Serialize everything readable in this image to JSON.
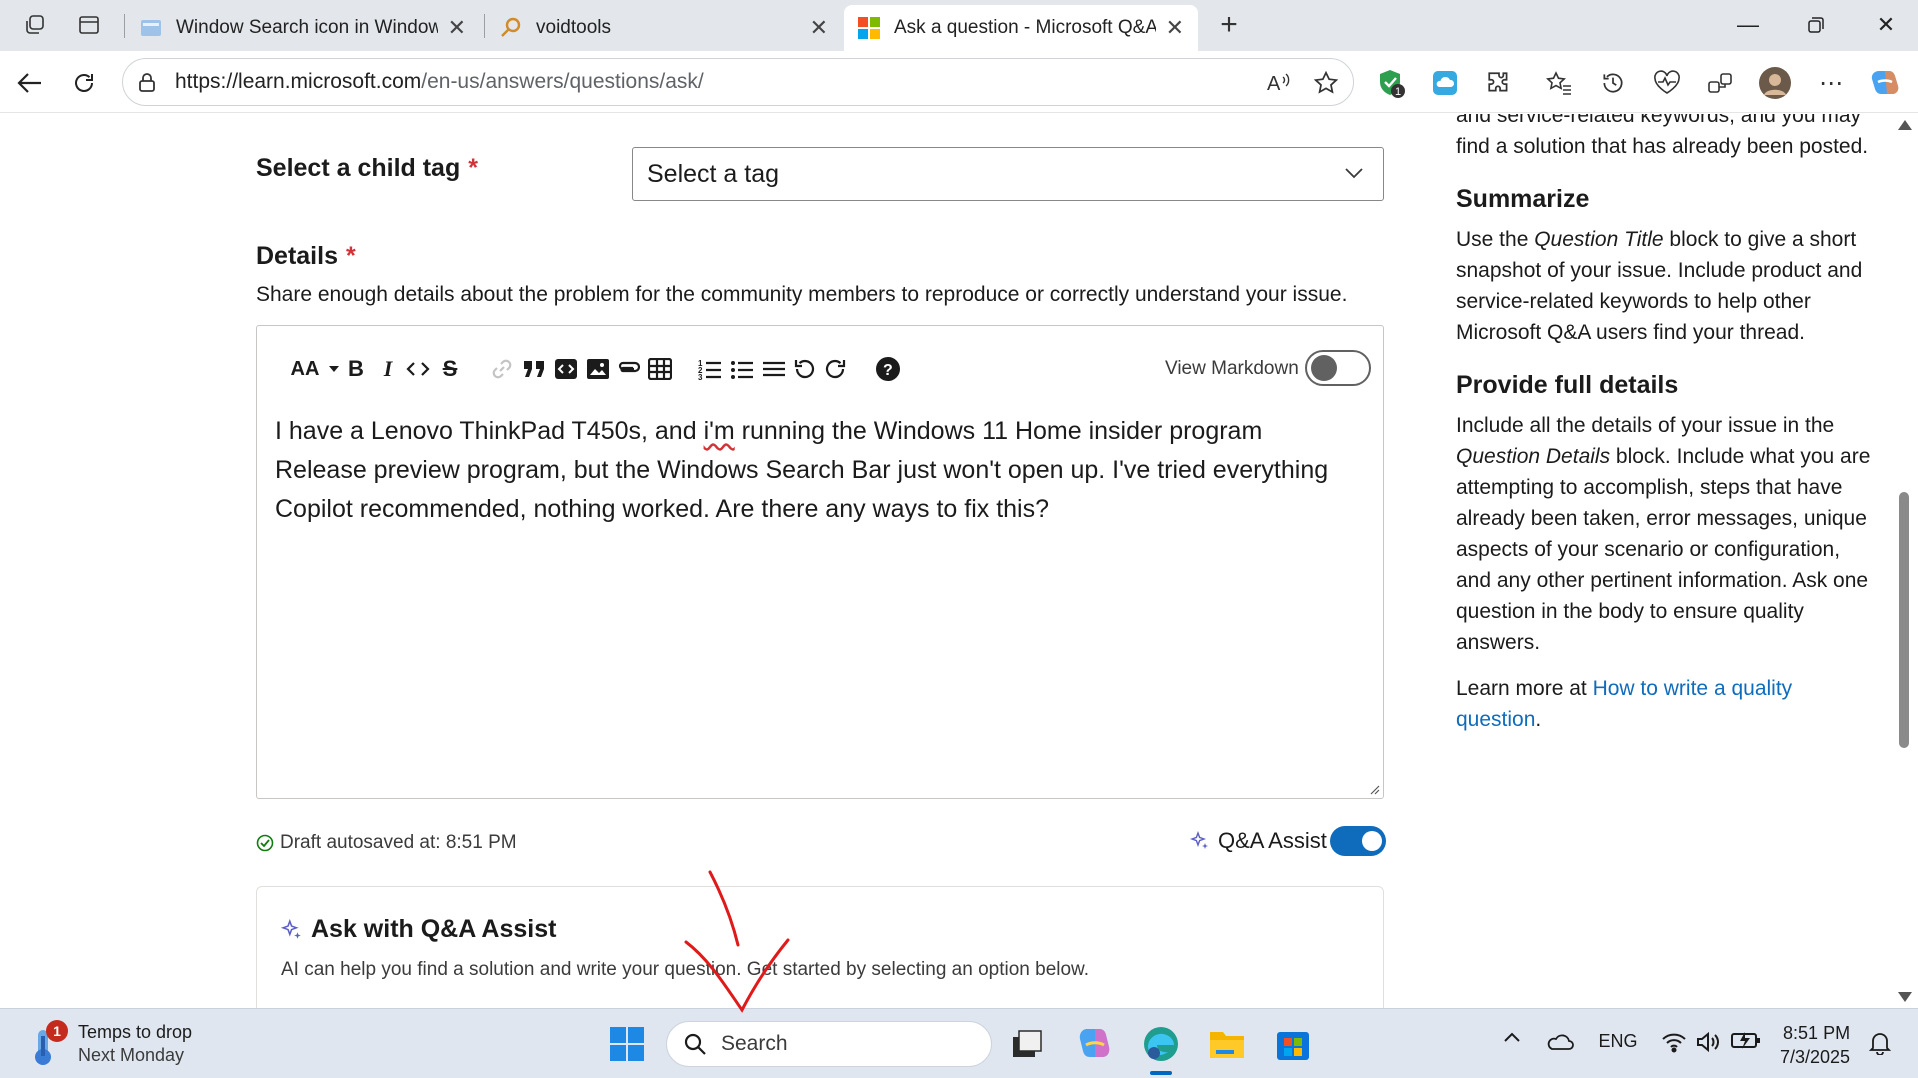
{
  "browser": {
    "tabs": [
      {
        "title": "Window Search icon in Windows 11",
        "active": false
      },
      {
        "title": "voidtools",
        "active": false
      },
      {
        "title": "Ask a question - Microsoft Q&A",
        "active": true
      }
    ],
    "address": {
      "url_host": "https://learn.microsoft.com",
      "url_path": "/en-us/answers/questions/ask/"
    },
    "extension_badge": "1"
  },
  "form": {
    "child_tag_label": "Select a child tag",
    "child_tag_placeholder": "Select a tag",
    "required_marker": "*",
    "details_label": "Details",
    "details_help": "Share enough details about the problem for the community members to reproduce or correctly understand your issue.",
    "editor": {
      "font_size_label": "AA",
      "view_markdown_label": "View Markdown",
      "view_markdown_on": false,
      "body_before": "I have a Lenovo ThinkPad T450s, and ",
      "body_misspelled": "i'm",
      "body_after": " running the Windows 11 Home insider program Release preview program, but the Windows Search Bar just won't open up. I've tried everything Copilot recommended, nothing worked. Are there any ways to fix this?"
    },
    "autosave_text": "Draft autosaved at: 8:51 PM",
    "qa_assist_label": "Q&A Assist",
    "qa_assist_on": true,
    "assist_card": {
      "title": "Ask with Q&A Assist",
      "subtitle": "AI can help you find a solution and write your question. Get started by selecting an option below."
    }
  },
  "sidebar": {
    "intro_fragment": "and service-related keywords, and you may find a solution that has already been posted.",
    "summarize_heading": "Summarize",
    "summarize_pre": "Use the ",
    "summarize_em": "Question Title",
    "summarize_post": " block to give a short snapshot of your issue. Include product and service-related keywords to help other Microsoft Q&A users find your thread.",
    "details_heading": "Provide full details",
    "details_pre": "Include all the details of your issue in the ",
    "details_em": "Question Details",
    "details_post": " block. Include what you are attempting to accomplish, steps that have already been taken, error messages, unique aspects of your scenario or configuration, and any other pertinent information. Ask one question in the body to ensure quality answers.",
    "learn_more_pre": "Learn more at ",
    "learn_more_link": "How to write a quality question",
    "learn_more_post": "."
  },
  "taskbar": {
    "weather_title": "Temps to drop",
    "weather_sub": "Next Monday",
    "weather_badge": "1",
    "search_placeholder": "Search",
    "language": "ENG",
    "time": "8:51 PM",
    "date": "7/3/2025"
  },
  "colors": {
    "accent": "#0f6cbd",
    "toggle_on": "#0f6cbd",
    "required": "#d13438",
    "annotation_red": "#e01a1a"
  }
}
